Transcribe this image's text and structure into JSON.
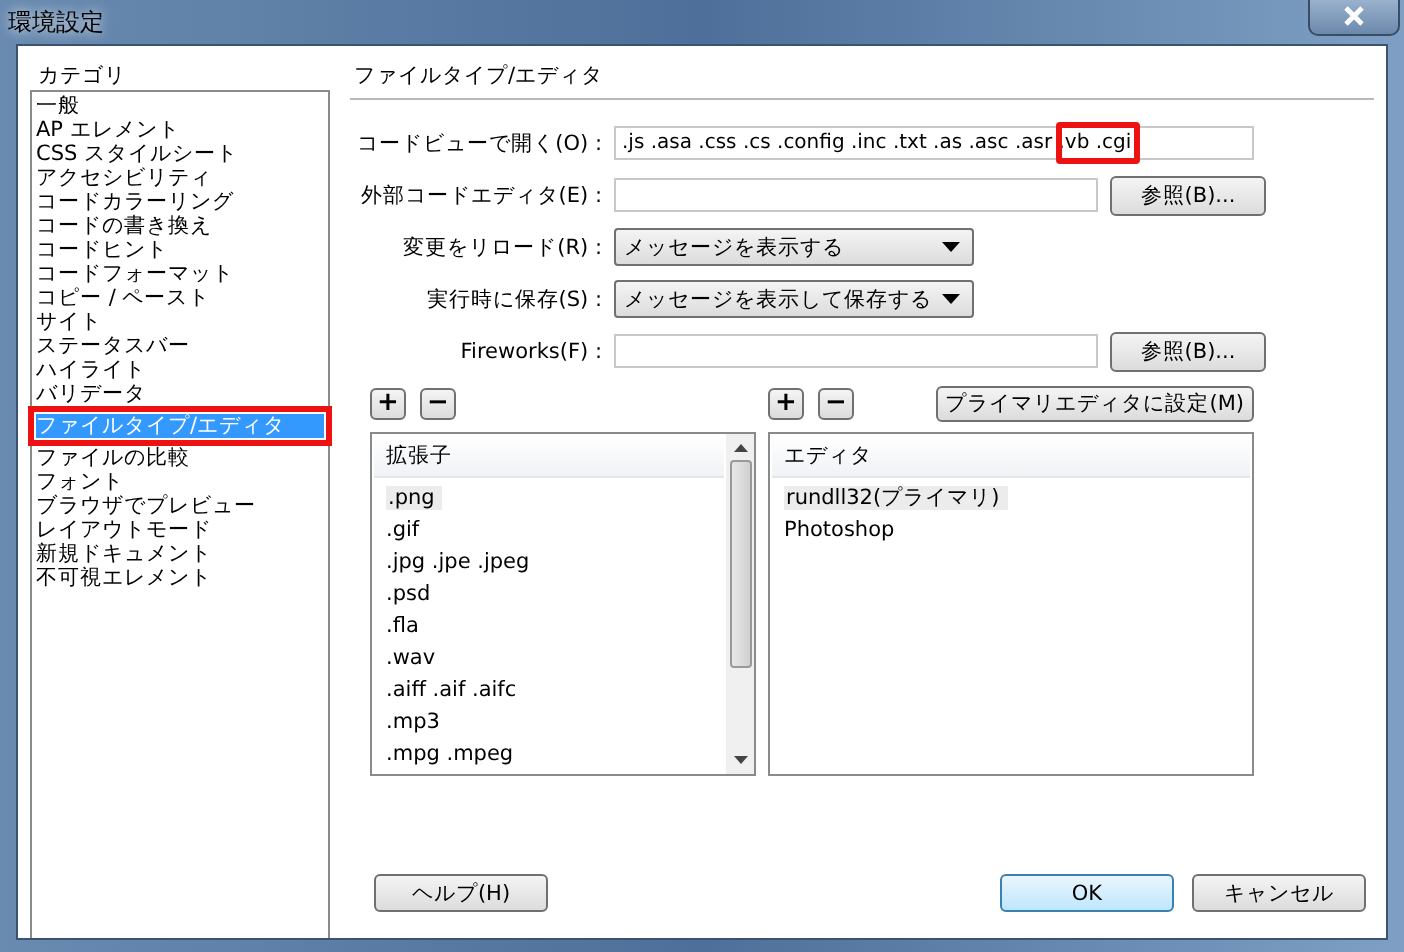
{
  "window": {
    "title": "環境設定"
  },
  "categories": {
    "heading": "カテゴリ",
    "items": [
      {
        "label": "一般",
        "selected": false
      },
      {
        "label": "AP エレメント",
        "selected": false
      },
      {
        "label": "CSS スタイルシート",
        "selected": false
      },
      {
        "label": "アクセシビリティ",
        "selected": false
      },
      {
        "label": "コードカラーリング",
        "selected": false
      },
      {
        "label": "コードの書き換え",
        "selected": false
      },
      {
        "label": "コードヒント",
        "selected": false
      },
      {
        "label": "コードフォーマット",
        "selected": false
      },
      {
        "label": "コピー / ペースト",
        "selected": false
      },
      {
        "label": "サイト",
        "selected": false
      },
      {
        "label": "ステータスバー",
        "selected": false
      },
      {
        "label": "ハイライト",
        "selected": false
      },
      {
        "label": "バリデータ",
        "selected": false
      },
      {
        "label": "ファイルタイプ/エディタ",
        "selected": true,
        "annotated": true
      },
      {
        "label": "ファイルの比較",
        "selected": false
      },
      {
        "label": "フォント",
        "selected": false
      },
      {
        "label": "ブラウザでプレビュー",
        "selected": false
      },
      {
        "label": "レイアウトモード",
        "selected": false
      },
      {
        "label": "新規ドキュメント",
        "selected": false
      },
      {
        "label": "不可視エレメント",
        "selected": false
      }
    ]
  },
  "panel": {
    "title": "ファイルタイプ/エディタ",
    "fields": [
      {
        "kind": "text",
        "label": "コードビューで開く(O) :",
        "value": ".js .asa .css .cs .config .inc .txt .as .asc .asr .vb .cgi",
        "annotated": true
      },
      {
        "kind": "browse",
        "label": "外部コードエディタ(E) :",
        "button": "参照(B)..."
      },
      {
        "kind": "select",
        "label": "変更をリロード(R) :",
        "value": "メッセージを表示する"
      },
      {
        "kind": "select",
        "label": "実行時に保存(S) :",
        "value": "メッセージを表示して保存する"
      },
      {
        "kind": "browse",
        "label": "Fireworks(F) :",
        "button": "参照(B)..."
      }
    ],
    "add_symbol": "+",
    "remove_symbol": "−",
    "primary_button": "プライマリエディタに設定(M)",
    "extensions": {
      "heading": "拡張子",
      "items": [
        {
          "label": ".png",
          "selected": true
        },
        {
          "label": ".gif",
          "selected": false
        },
        {
          "label": ".jpg .jpe .jpeg",
          "selected": false
        },
        {
          "label": ".psd",
          "selected": false
        },
        {
          "label": ".fla",
          "selected": false
        },
        {
          "label": ".wav",
          "selected": false
        },
        {
          "label": ".aiff .aif .aifc",
          "selected": false
        },
        {
          "label": ".mp3",
          "selected": false
        },
        {
          "label": ".mpg .mpeg",
          "selected": false
        }
      ]
    },
    "editors": {
      "heading": "エディタ",
      "items": [
        {
          "label": "rundll32(プライマリ)",
          "selected": true
        },
        {
          "label": "Photoshop",
          "selected": false
        }
      ]
    }
  },
  "buttons": {
    "help": "ヘルプ(H)",
    "ok": "OK",
    "cancel": "キャンセル"
  }
}
